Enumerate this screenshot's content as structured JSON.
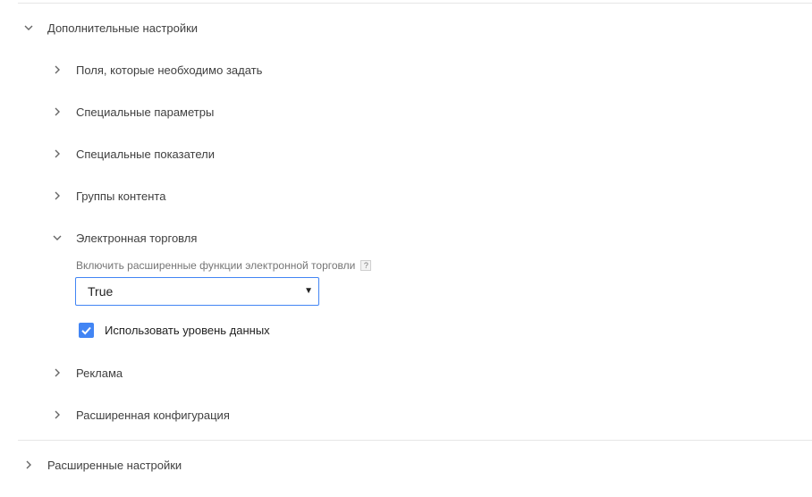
{
  "advanced_settings": {
    "label": "Дополнительные настройки",
    "expanded": true,
    "items": [
      {
        "label": "Поля, которые необходимо задать",
        "expanded": false
      },
      {
        "label": "Специальные параметры",
        "expanded": false
      },
      {
        "label": "Специальные показатели",
        "expanded": false
      },
      {
        "label": "Группы контента",
        "expanded": false
      },
      {
        "label": "Электронная торговля",
        "expanded": true
      },
      {
        "label": "Реклама",
        "expanded": false
      },
      {
        "label": "Расширенная конфигурация",
        "expanded": false
      }
    ]
  },
  "ecommerce": {
    "enhanced_label": "Включить расширенные функции электронной торговли",
    "help_glyph": "?",
    "enhanced_value": "True",
    "dropdown_glyph": "▼",
    "use_data_layer_label": "Использовать уровень данных",
    "use_data_layer_checked": true
  },
  "extended_settings": {
    "label": "Расширенные настройки",
    "expanded": false
  },
  "icons": {
    "collapsed": "chevron-right-icon",
    "expanded": "chevron-down-icon",
    "checkbox": "check-icon"
  },
  "colors": {
    "accent": "#4285f4",
    "text": "#404040",
    "muted": "#757575",
    "divider": "#e6e6e6"
  }
}
